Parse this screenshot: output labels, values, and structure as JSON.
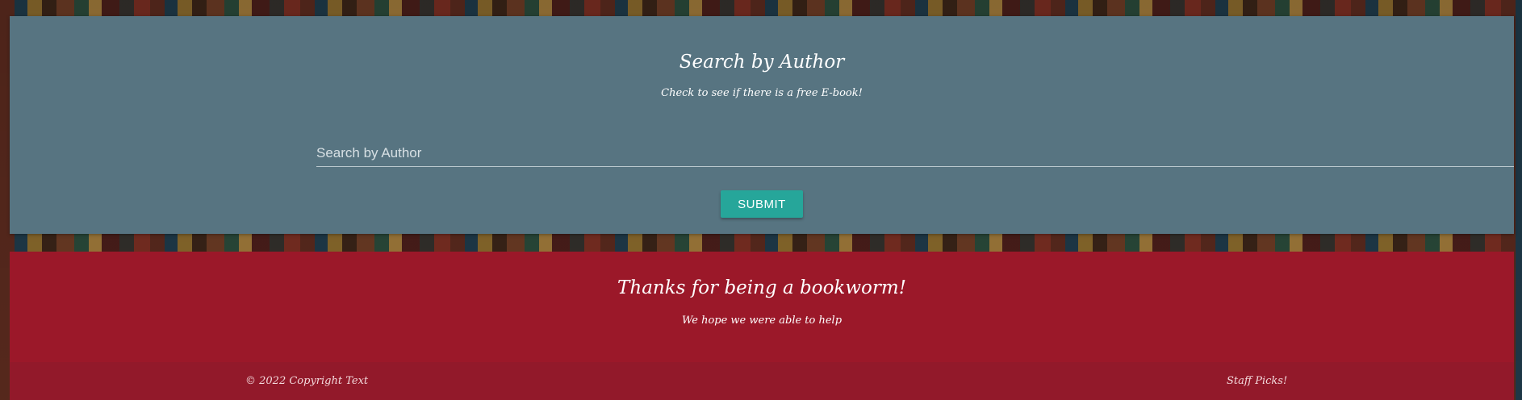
{
  "search": {
    "title": "Search by Author",
    "subtitle": "Check to see if there is a free E-book!",
    "input_placeholder": "Search by Author",
    "input_value": "",
    "submit_label": "SUBMIT"
  },
  "footer": {
    "title": "Thanks for being a bookworm!",
    "subtitle": "We hope we were able to help",
    "copyright": "© 2022 Copyright Text",
    "staff_picks_link": "Staff Picks!"
  },
  "colors": {
    "search_card": "#577481",
    "submit_button": "#26a69a",
    "footer": "#9b1829",
    "footer_bar": "#92192a"
  }
}
